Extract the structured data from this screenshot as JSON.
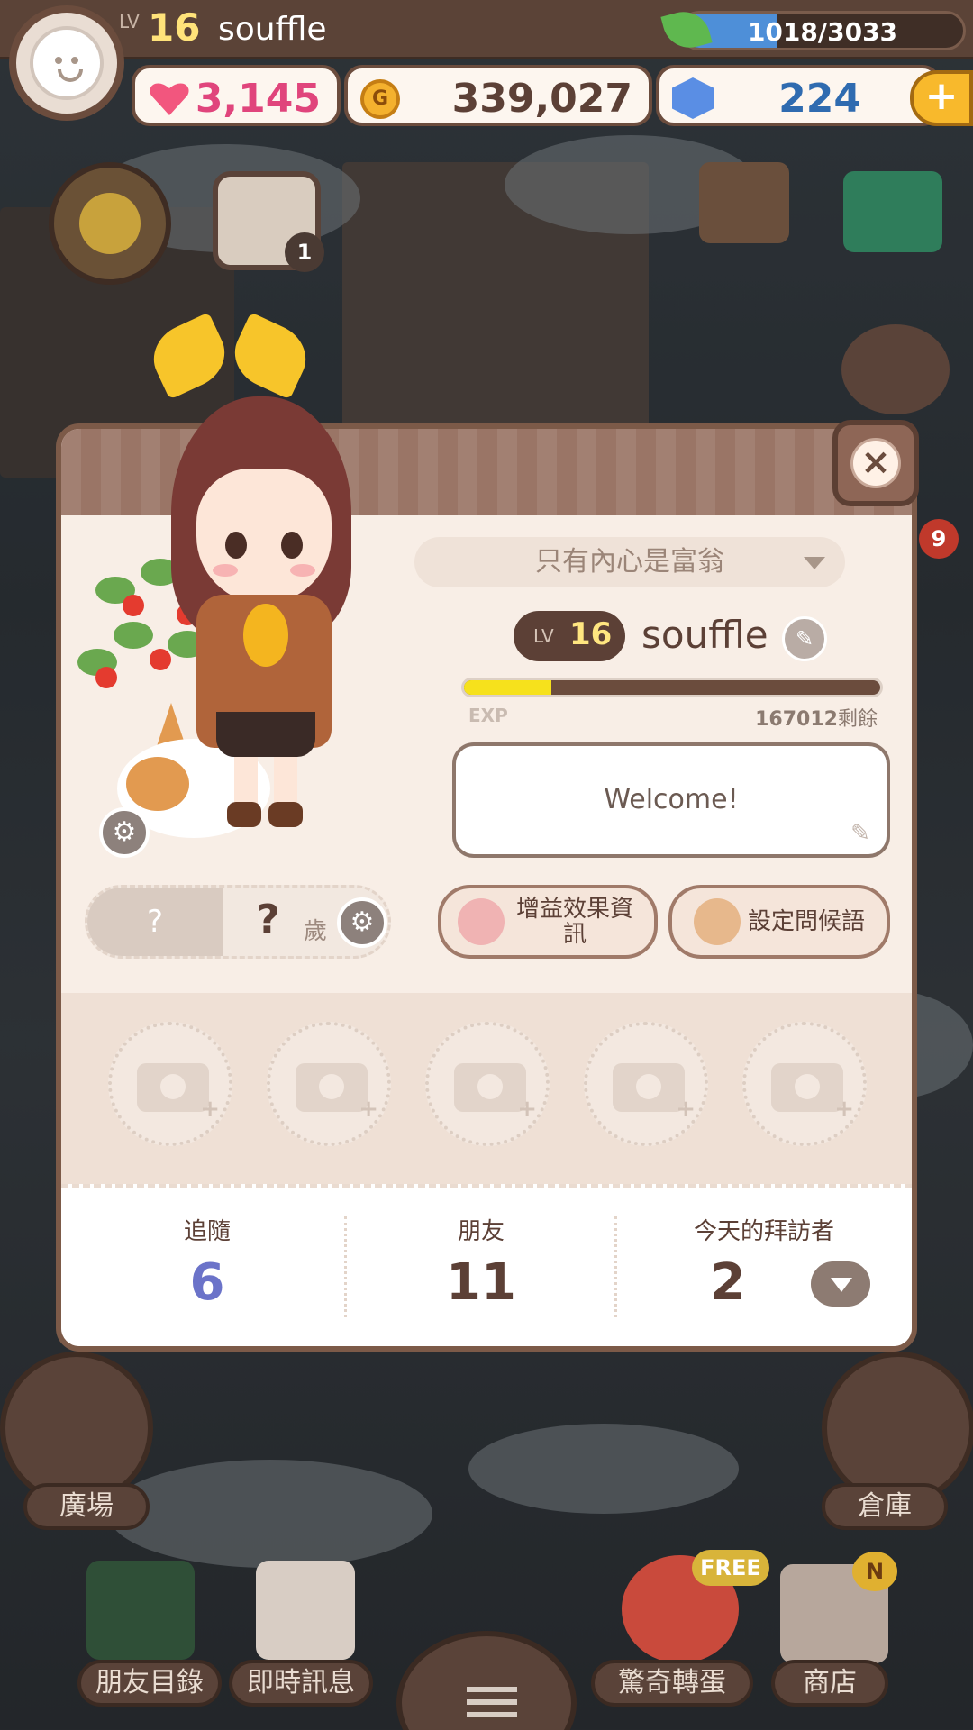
{
  "hud": {
    "level_label": "LV",
    "level": "16",
    "name": "souffle",
    "exp_text": "1018/3033",
    "exp_fraction": 0.336,
    "hearts": "3,145",
    "coins": "339,027",
    "gems": "224",
    "plus": "+"
  },
  "scene": {
    "calendar_badge": "1",
    "side_badge": "9",
    "free_badge": "FREE",
    "new_badge": "N",
    "bottom_nav": [
      "廣場",
      "倉庫",
      "朋友目錄",
      "即時訊息",
      "驚奇轉蛋",
      "商店"
    ]
  },
  "profile": {
    "title_dropdown": "只有內心是富翁",
    "level_label": "LV",
    "level": "16",
    "name": "souffle",
    "exp_label": "EXP",
    "exp_fraction": 0.21,
    "exp_remaining": "167012",
    "exp_remaining_suffix": "剩餘",
    "greeting": "Welcome!",
    "gender_mark": "?",
    "age": "?",
    "age_unit": "歲",
    "buff_button": "增益效果資訊",
    "greeting_button": "設定問候語",
    "close": "×",
    "stats": {
      "follow_label": "追隨",
      "follow_value": "6",
      "friends_label": "朋友",
      "friends_value": "11",
      "visitors_label": "今天的拜訪者",
      "visitors_value": "2"
    }
  },
  "colors": {
    "follow": "#6b73c9",
    "friends": "#5c4036",
    "visitors": "#5c4036",
    "heart_text": "#e0457c",
    "coin_text": "#5c4036",
    "gem_text": "#2f6bb0"
  }
}
